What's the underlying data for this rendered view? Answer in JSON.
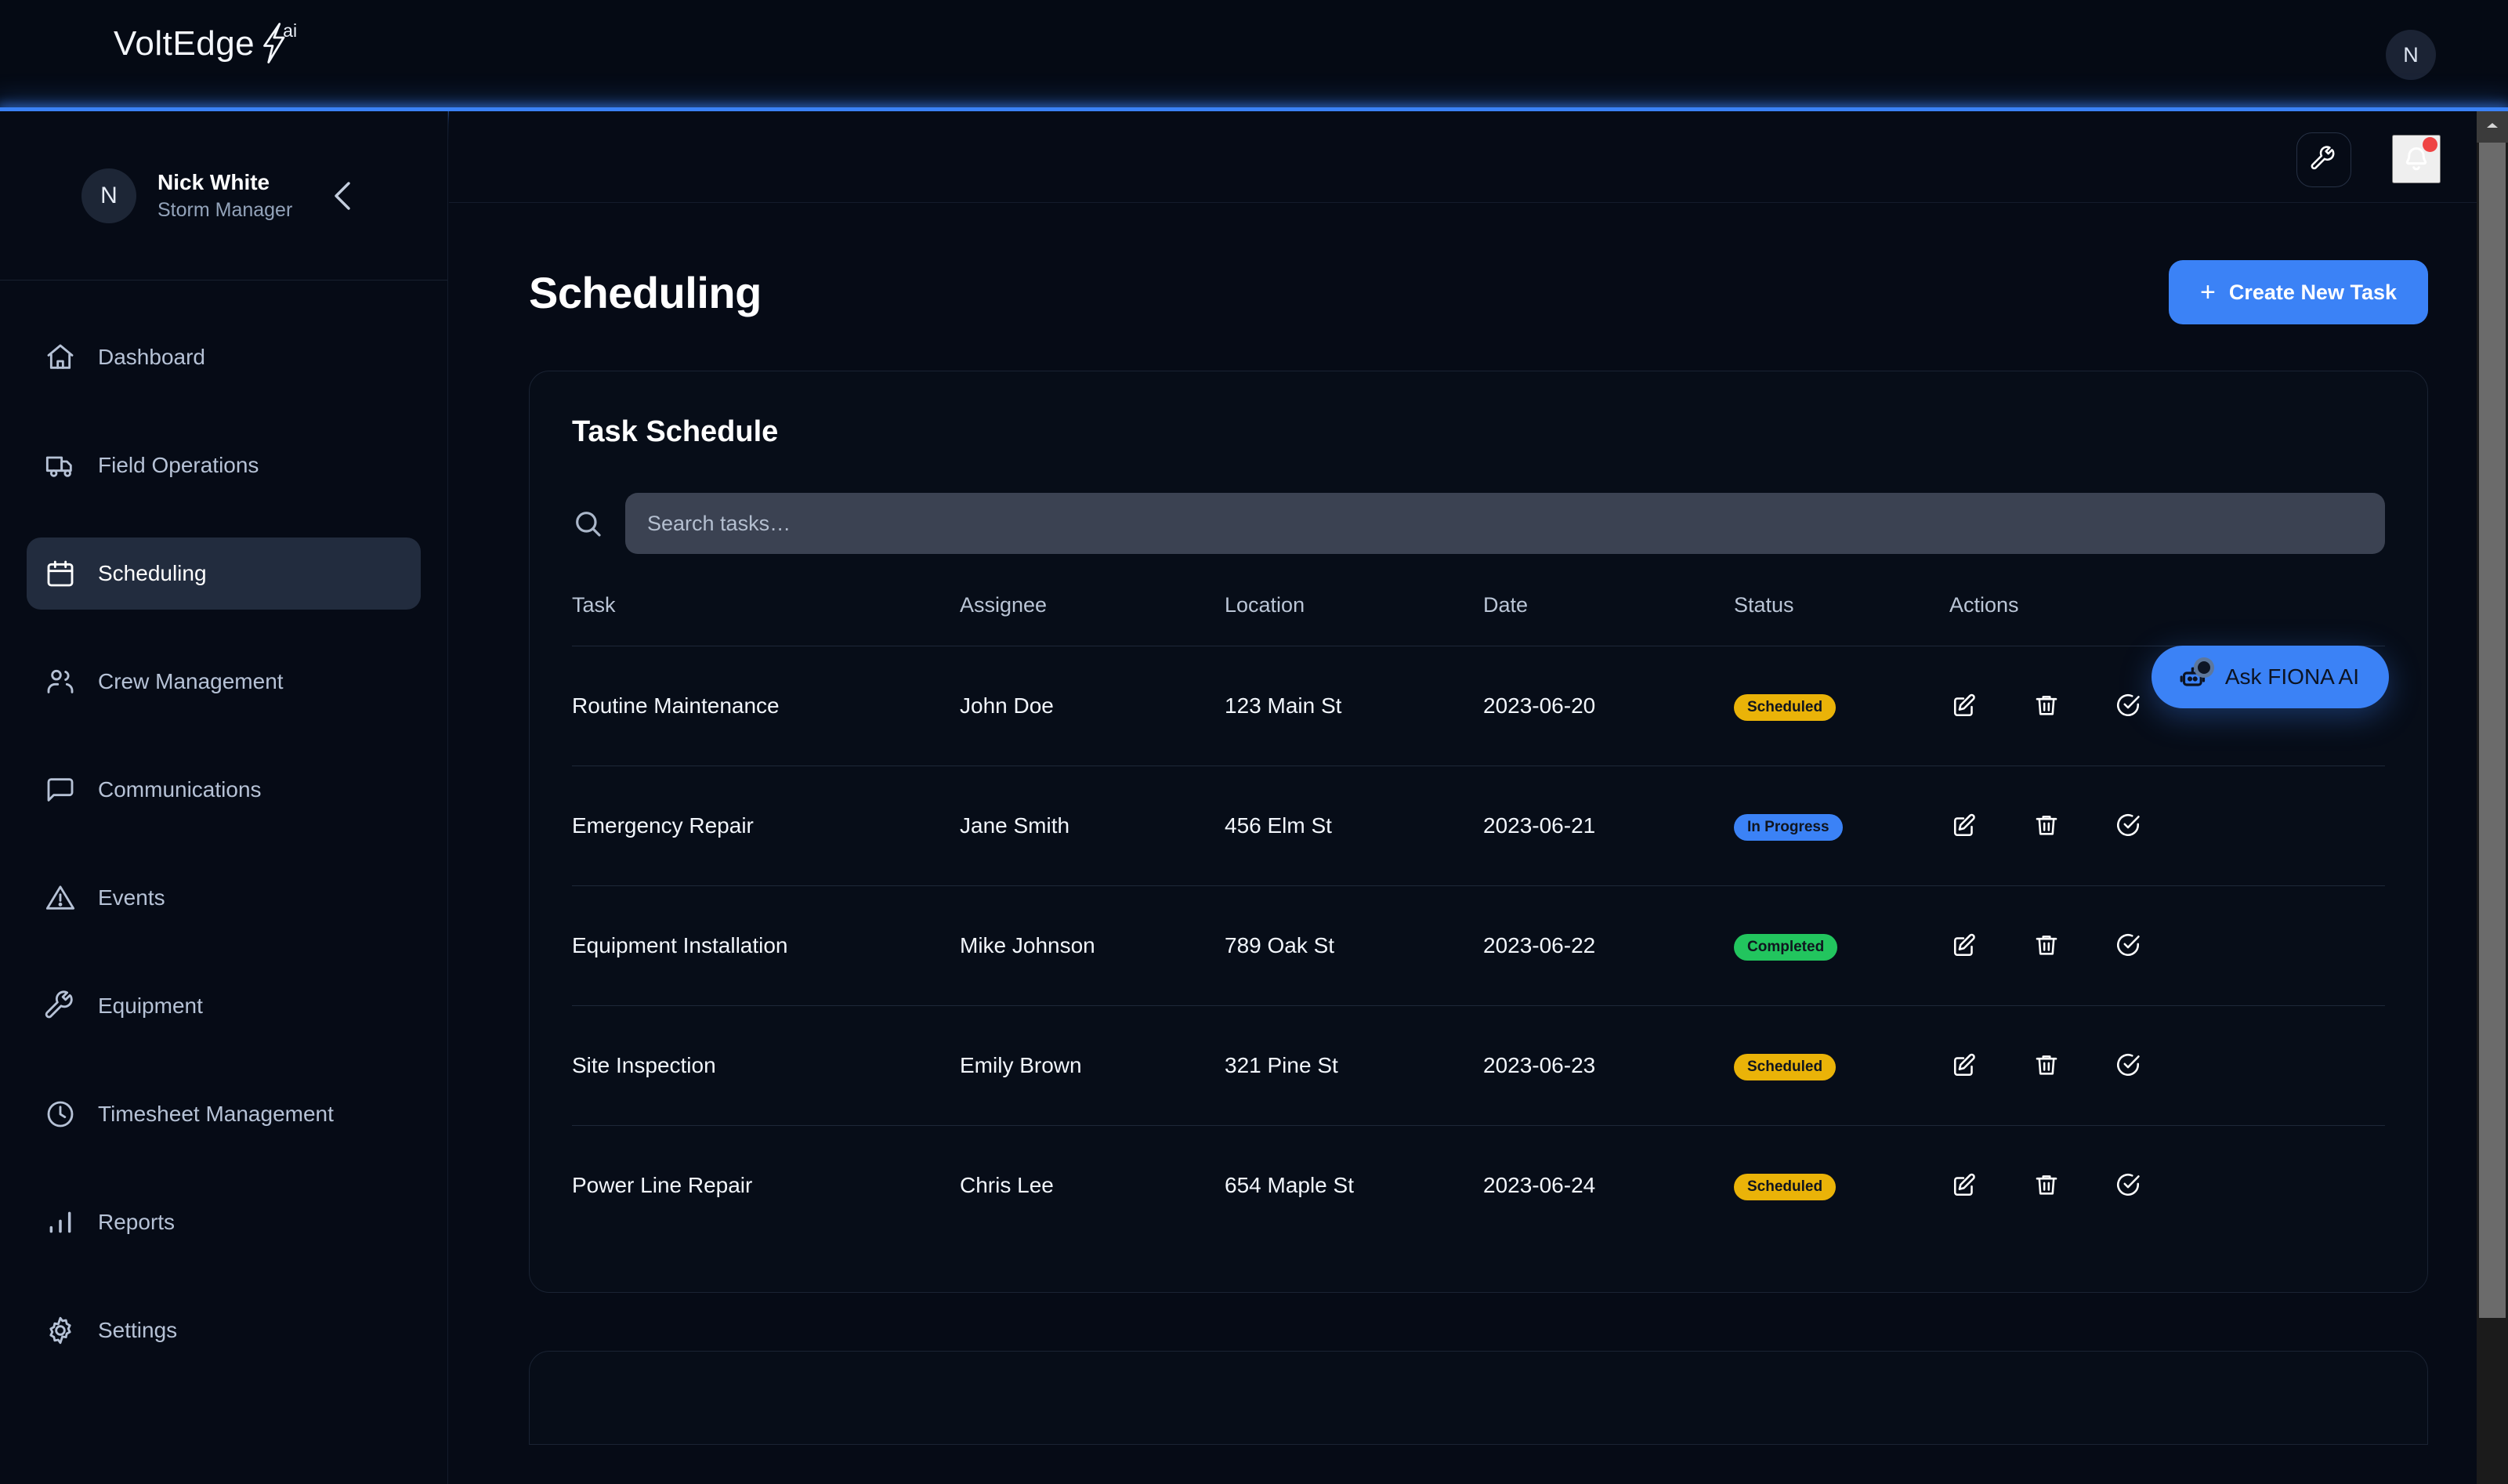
{
  "brand": {
    "name": "VoltEdge",
    "superscript": "ai",
    "bolt_icon": "lightning-bolt-icon"
  },
  "topbar": {
    "avatar_initial": "N"
  },
  "sidebar": {
    "profile": {
      "initial": "N",
      "name": "Nick White",
      "role": "Storm Manager",
      "collapse_icon": "chevron-left-icon"
    },
    "items": [
      {
        "label": "Dashboard",
        "icon": "home-icon",
        "active": false
      },
      {
        "label": "Field Operations",
        "icon": "truck-icon",
        "active": false
      },
      {
        "label": "Scheduling",
        "icon": "calendar-icon",
        "active": true
      },
      {
        "label": "Crew Management",
        "icon": "users-icon",
        "active": false
      },
      {
        "label": "Communications",
        "icon": "message-square-icon",
        "active": false
      },
      {
        "label": "Events",
        "icon": "alert-triangle-icon",
        "active": false
      },
      {
        "label": "Equipment",
        "icon": "wrench-icon",
        "active": false
      },
      {
        "label": "Timesheet Management",
        "icon": "clock-icon",
        "active": false
      },
      {
        "label": "Reports",
        "icon": "bar-chart-icon",
        "active": false
      },
      {
        "label": "Settings",
        "icon": "gear-icon",
        "active": false
      }
    ]
  },
  "toolbar": {
    "tool_icon": "wrench-icon",
    "notifications_icon": "bell-icon",
    "has_notification": true
  },
  "page": {
    "title": "Scheduling",
    "create_button": "Create New Task",
    "create_button_icon": "plus-icon",
    "accent_color": "#3b82f6"
  },
  "card": {
    "title": "Task Schedule",
    "search": {
      "icon": "search-icon",
      "placeholder": "Search tasks…",
      "value": ""
    },
    "columns": [
      "Task",
      "Assignee",
      "Location",
      "Date",
      "Status",
      "Actions"
    ],
    "row_actions": [
      {
        "icon": "edit-icon",
        "name": "edit-task-button"
      },
      {
        "icon": "trash-icon",
        "name": "delete-task-button"
      },
      {
        "icon": "check-circle-icon",
        "name": "complete-task-button"
      }
    ],
    "rows": [
      {
        "task": "Routine Maintenance",
        "assignee": "John Doe",
        "location": "123 Main St",
        "date": "2023-06-20",
        "status": "Scheduled",
        "status_key": "scheduled"
      },
      {
        "task": "Emergency Repair",
        "assignee": "Jane Smith",
        "location": "456 Elm St",
        "date": "2023-06-21",
        "status": "In Progress",
        "status_key": "inprogress"
      },
      {
        "task": "Equipment Installation",
        "assignee": "Mike Johnson",
        "location": "789 Oak St",
        "date": "2023-06-22",
        "status": "Completed",
        "status_key": "completed"
      },
      {
        "task": "Site Inspection",
        "assignee": "Emily Brown",
        "location": "321 Pine St",
        "date": "2023-06-23",
        "status": "Scheduled",
        "status_key": "scheduled"
      },
      {
        "task": "Power Line Repair",
        "assignee": "Chris Lee",
        "location": "654 Maple St",
        "date": "2023-06-24",
        "status": "Scheduled",
        "status_key": "scheduled"
      }
    ],
    "status_colors": {
      "scheduled": "#eab308",
      "inprogress": "#3b82f6",
      "completed": "#22c55e"
    }
  },
  "fiona": {
    "label": "Ask FIONA AI",
    "icon": "robot-icon"
  }
}
